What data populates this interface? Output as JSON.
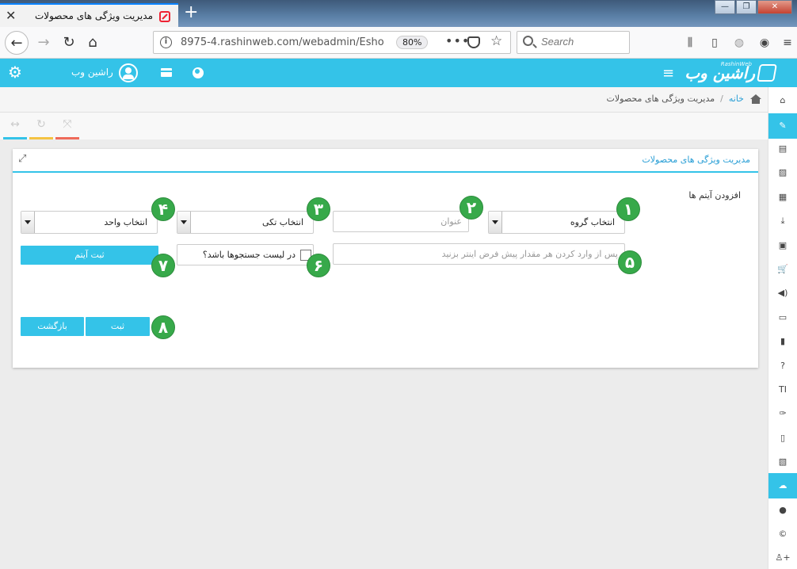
{
  "browser": {
    "tab_title": "مدیریت ویژگی های محصولات",
    "tab_close": "✕",
    "new_tab": "+",
    "url": "8975-4.rashinweb.com/webadmin/Esho",
    "zoom": "80%",
    "search_placeholder": "Search"
  },
  "header": {
    "user_name": "راشین وب",
    "logo_text": "راشین وب",
    "logo_sub": "RashinWeb"
  },
  "breadcrumb": {
    "home": "خانه",
    "separator": "/",
    "current": "مدیریت ویژگی های محصولات"
  },
  "panel": {
    "title": "مدیریت ویژگی های محصولات",
    "section_label": "افزودن آیتم ها",
    "group_select": "انتخاب گروه",
    "title_placeholder": "عنوان",
    "option_select": "انتخاب تکی",
    "unit_select": "انتخاب واحد",
    "value_placeholder": "پس از وارد کردن هر مقدار پیش فرض اینتر بزنید",
    "search_list_checkbox": "در لیست جستجوها باشد؟",
    "add_item_button": "ثبت آیتم",
    "submit_button": "ثبت",
    "back_button": "بازگشت"
  },
  "badges": [
    "۱",
    "۲",
    "۳",
    "۴",
    "۵",
    "۶",
    "۷",
    "۸"
  ],
  "colors": {
    "accent": "#34c3e8",
    "badge": "#37a94a",
    "tool_bar_1": "#34c3e8",
    "tool_bar_2": "#f5c342",
    "tool_bar_3": "#ef6a5a"
  },
  "sidebar_icons": [
    "home-icon",
    "pencil-icon",
    "list-icon",
    "image-icon",
    "document-icon",
    "download-icon",
    "film-icon",
    "cart-icon",
    "megaphone-icon",
    "monitor-icon",
    "book-icon",
    "question-icon",
    "text-icon",
    "pin-icon",
    "file-icon",
    "excel-icon",
    "users-icon",
    "user-icon",
    "copyright-icon",
    "add-user-icon"
  ],
  "sidebar_glyphs": [
    "⌂",
    "✎",
    "▤",
    "▨",
    "▦",
    "⤓",
    "▣",
    "🛒",
    "◀)",
    "▭",
    "▮",
    "?",
    "TI",
    "✑",
    "▯",
    "▧",
    "☁",
    "●",
    "©",
    "♙+"
  ]
}
